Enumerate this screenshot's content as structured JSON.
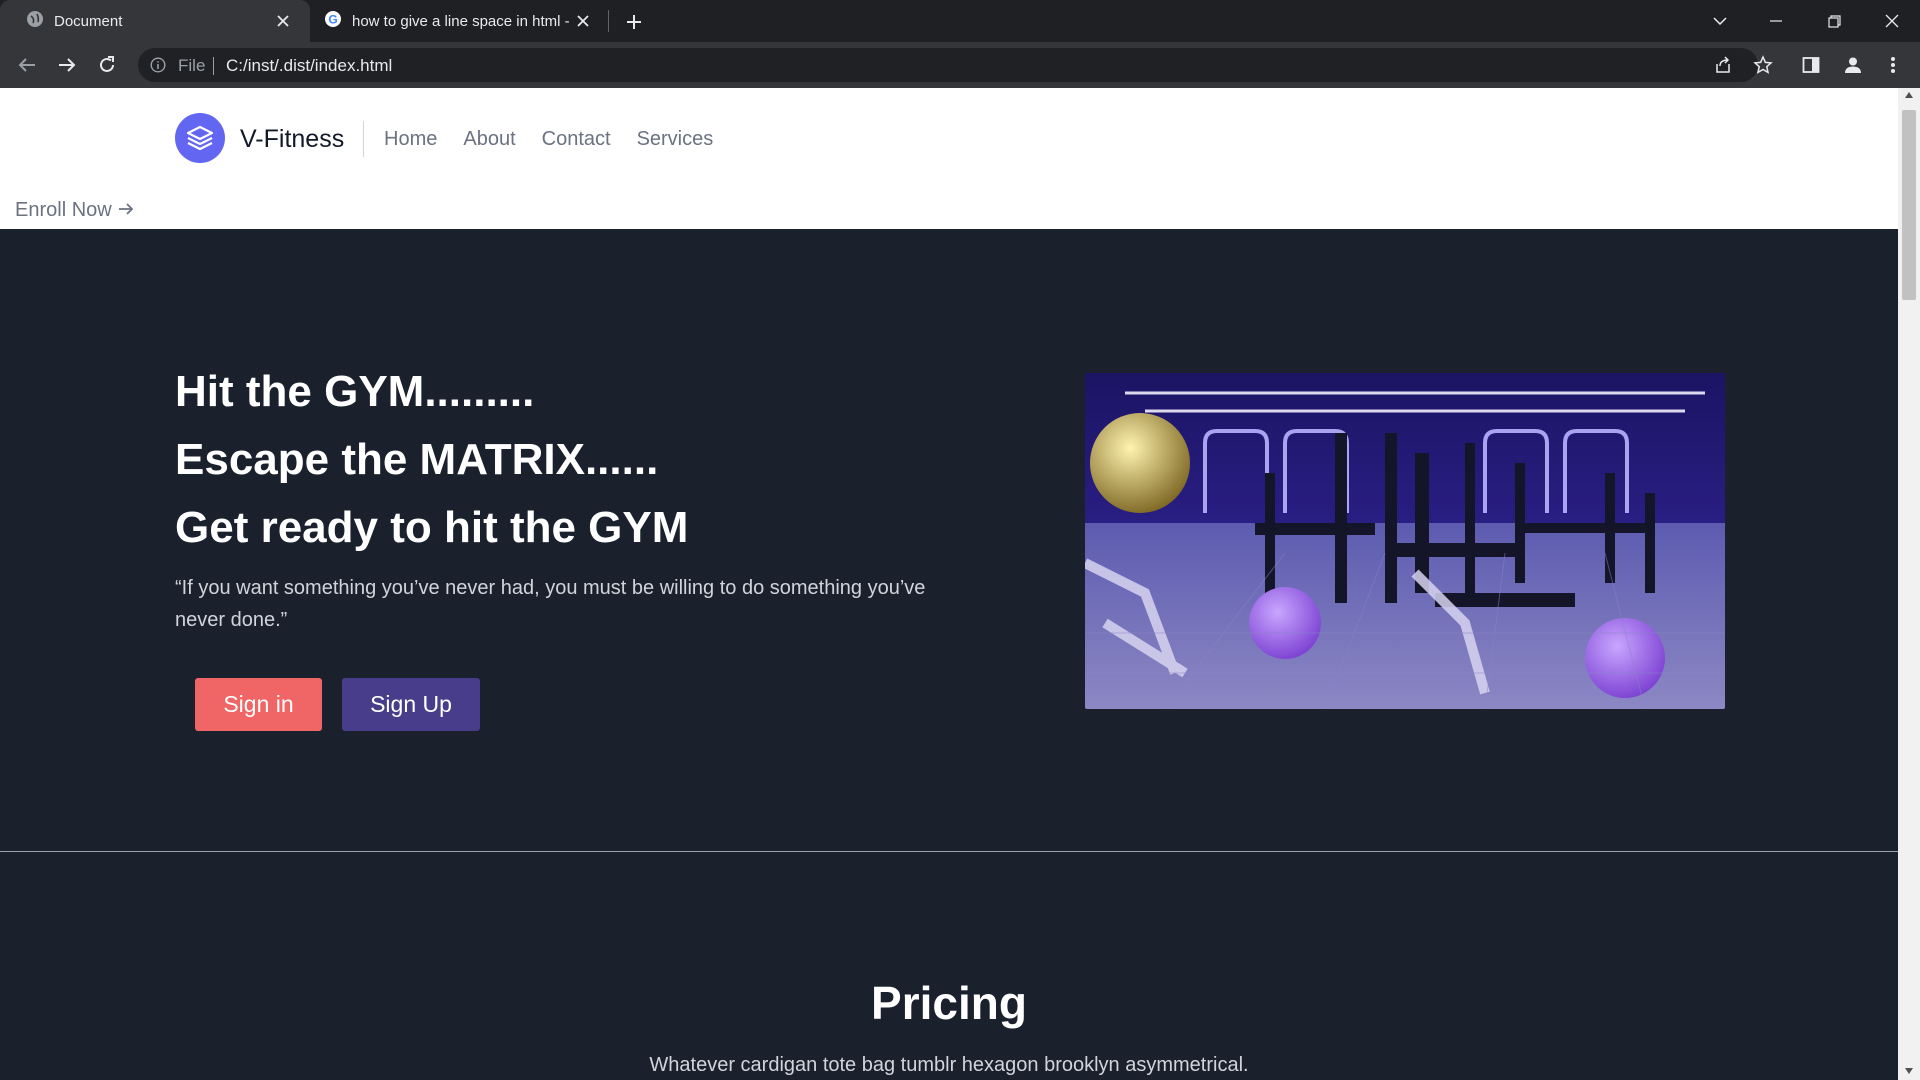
{
  "browser": {
    "tabs": [
      {
        "title": "Document",
        "active": true
      },
      {
        "title": "how to give a line space in html -",
        "active": false
      }
    ],
    "address": {
      "scheme_label": "File",
      "url": "C:/inst/.dist/index.html"
    }
  },
  "site": {
    "brand": "V-Fitness",
    "nav": [
      "Home",
      "About",
      "Contact",
      "Services"
    ],
    "enroll": "Enroll Now"
  },
  "hero": {
    "lines": [
      "Hit the GYM.........",
      "Escape the MATRIX......",
      "Get ready to hit the GYM"
    ],
    "quote": "“If you want something you’ve never had, you must be willing to do something you’ve never done.”",
    "signin_label": "Sign in",
    "signup_label": "Sign Up"
  },
  "pricing": {
    "title": "Pricing",
    "subtitle": "Whatever cardigan tote bag tumblr hexagon brooklyn asymmetrical."
  },
  "colors": {
    "page_bg": "#1a202c",
    "brand_accent": "#6366f1",
    "signin_bg": "#f06565",
    "signup_bg": "#483d8b"
  }
}
